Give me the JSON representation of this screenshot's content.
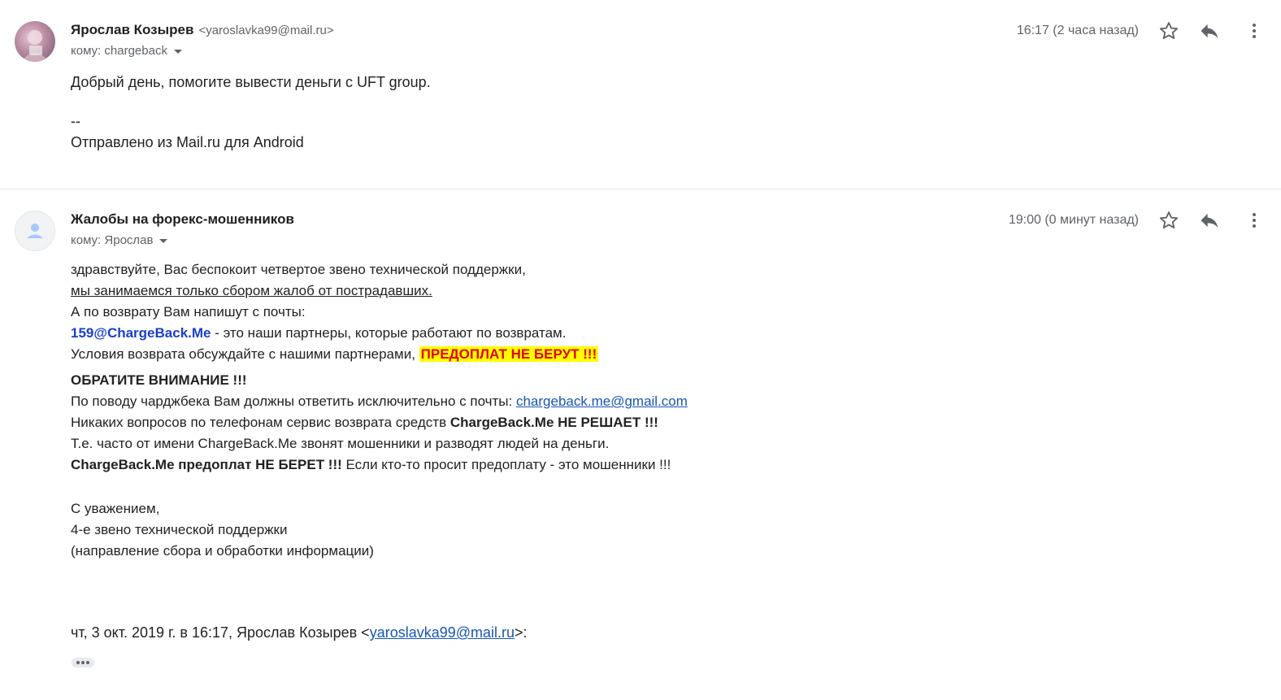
{
  "messages": [
    {
      "sender_name": "Ярослав Козырев",
      "sender_email": "<yaroslavka99@mail.ru>",
      "to": "кому: chargeback",
      "time": "16:17 (2 часа назад)",
      "body": {
        "line1": "Добрый день, помогите вывести деньги с UFT group.",
        "line2": "--",
        "line3": "Отправлено из Mail.ru для Android"
      }
    },
    {
      "sender_name": "Жалобы на форекс-мошенников",
      "to": "кому: Ярослав",
      "time": "19:00 (0 минут назад)",
      "body": {
        "l1": "здравствуйте, Вас беспокоит четвертое звено технической поддержки,",
        "l2": "мы занимаемся только сбором жалоб от пострадавших.",
        "l3": "А по возврату Вам напишут с почты:",
        "l4_email": "159@ChargeBack.Me",
        "l4_text": " - это наши партнеры, которые работают по возвратам.",
        "l5_text": "Условия возврата обсуждайте с нашими партнерами, ",
        "l5_warn": "ПРЕДОПЛАТ НЕ БЕРУТ !!!",
        "l6": "ОБРАТИТЕ ВНИМАНИЕ !!!",
        "l7_text": "По поводу чарджбека Вам должны ответить исключительно с почты: ",
        "l7_link": "chargeback.me@gmail.com",
        "l8_text": "Никаких вопросов по телефонам сервис возврата средств ",
        "l8_bold": "ChargeBack.Me НЕ РЕШАЕТ !!!",
        "l9": "Т.е. часто от имени ChargeBack.Me звонят мошенники и разводят людей на деньги.",
        "l10_bold": "ChargeBack.Me предоплат НЕ БЕРЕТ !!!",
        "l10_text": " Если кто-то просит предоплату - это мошенники !!!",
        "sig1": "С уважением,",
        "sig2": "4-е звено технической поддержки",
        "sig3": "(направление сбора и обработки информации)"
      },
      "quote_prefix": "чт, 3 окт. 2019 г. в 16:17, Ярослав Козырев <",
      "quote_email": "yaroslavka99@mail.ru",
      "quote_suffix": ">:"
    }
  ],
  "icons": [
    "avatar",
    "star-icon",
    "reply-icon",
    "more-vert-icon",
    "person-icon",
    "ellipsis-icon"
  ],
  "colors": {
    "link": "#1a55b5",
    "partner_email": "#1a3fcc",
    "warning_text": "#e60000",
    "warning_highlight": "#ffff00"
  }
}
